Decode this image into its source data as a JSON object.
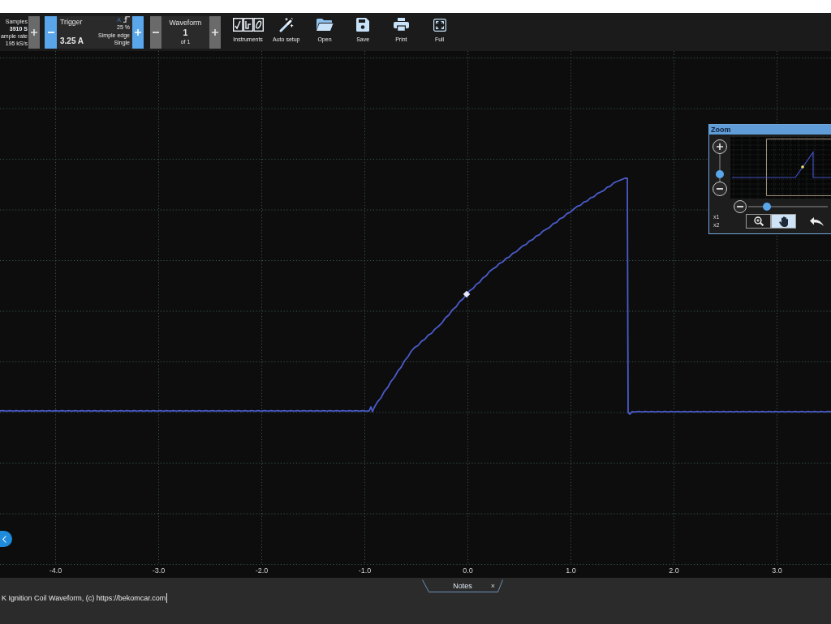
{
  "toolbar": {
    "samples": {
      "label": "Samples",
      "value": "3910 S",
      "rate_label": "ample rate",
      "rate": "195 kS/s"
    },
    "trigger": {
      "label": "Trigger",
      "value": "3.25 A",
      "channel": "A",
      "threshold": "25 %",
      "type": "Simple edge",
      "mode": "Single"
    },
    "waveform": {
      "label": "Waveform",
      "value": "1",
      "count": "of 1"
    },
    "tools": [
      {
        "kind": "instruments",
        "label": "Instruments"
      },
      {
        "kind": "autosetup",
        "label": "Auto setup"
      },
      {
        "kind": "open",
        "label": "Open"
      },
      {
        "kind": "save",
        "label": "Save"
      },
      {
        "kind": "print",
        "label": "Print"
      },
      {
        "kind": "full",
        "label": "Full"
      }
    ]
  },
  "plot": {
    "x_tick_labels": [
      "-4.0",
      "-3.0",
      "-2.0",
      "-1.0",
      "0.0",
      "1.0",
      "2.0",
      "3.0"
    ]
  },
  "zoom_panel": {
    "title": "Zoom",
    "vertical_zoom": {
      "level": 0.15
    },
    "horizontal_zoom": {
      "level": 0.2
    },
    "scale_labels": [
      "x1",
      "x2"
    ],
    "tools": [
      {
        "kind": "magnify",
        "selected": false
      },
      {
        "kind": "pan",
        "selected": true
      }
    ]
  },
  "notes": {
    "tab": {
      "label": "Notes",
      "close": "×"
    },
    "text": "K Ignition Coil Waveform, (c) https://bekomcar.com"
  }
}
